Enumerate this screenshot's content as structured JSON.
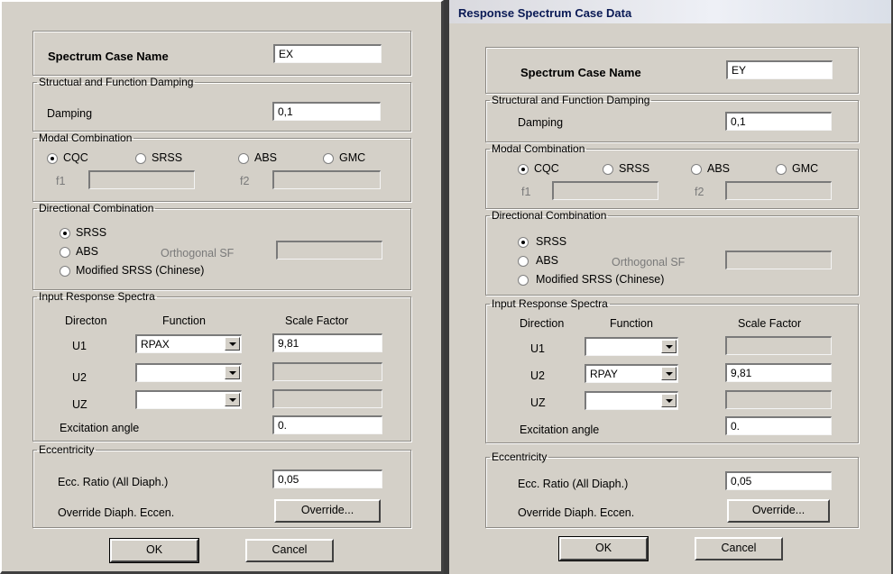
{
  "left": {
    "spectrum_case_name_label": "Spectrum Case Name",
    "spectrum_case_name_value": "EX",
    "damping_group": "Structual and Function Damping",
    "damping_label": "Damping",
    "damping_value": "0,1",
    "modal_group": "Modal Combination",
    "modal_options": [
      "CQC",
      "SRSS",
      "ABS",
      "GMC"
    ],
    "modal_selected": "CQC",
    "f1_label": "f1",
    "f2_label": "f2",
    "directional_group": "Directional Combination",
    "directional_options": [
      "SRSS",
      "ABS",
      "Modified SRSS (Chinese)"
    ],
    "directional_selected": "SRSS",
    "orthogonal_label": "Orthogonal SF",
    "input_group": "Input Response Spectra",
    "col_direction": "Directon",
    "col_function": "Function",
    "col_scale": "Scale Factor",
    "rows": [
      {
        "dir": "U1",
        "function": "RPAX",
        "scale": "9,81"
      },
      {
        "dir": "U2",
        "function": "",
        "scale": ""
      },
      {
        "dir": "UZ",
        "function": "",
        "scale": ""
      }
    ],
    "excitation_label": "Excitation angle",
    "excitation_value": "0.",
    "ecc_group": "Eccentricity",
    "ecc_ratio_label": "Ecc. Ratio (All Diaph.)",
    "ecc_ratio_value": "0,05",
    "override_label": "Override Diaph. Eccen.",
    "override_button": "Override...",
    "ok_button": "OK",
    "cancel_button": "Cancel"
  },
  "right": {
    "title": "Response Spectrum Case Data",
    "spectrum_case_name_label": "Spectrum Case Name",
    "spectrum_case_name_value": "EY",
    "damping_group": "Structural and Function Damping",
    "damping_label": "Damping",
    "damping_value": "0,1",
    "modal_group": "Modal Combination",
    "modal_options": [
      "CQC",
      "SRSS",
      "ABS",
      "GMC"
    ],
    "modal_selected": "CQC",
    "f1_label": "f1",
    "f2_label": "f2",
    "directional_group": "Directional Combination",
    "directional_options": [
      "SRSS",
      "ABS",
      "Modified SRSS (Chinese)"
    ],
    "directional_selected": "SRSS",
    "orthogonal_label": "Orthogonal SF",
    "input_group": "Input Response Spectra",
    "col_direction": "Direction",
    "col_function": "Function",
    "col_scale": "Scale Factor",
    "rows": [
      {
        "dir": "U1",
        "function": "",
        "scale": ""
      },
      {
        "dir": "U2",
        "function": "RPAY",
        "scale": "9,81"
      },
      {
        "dir": "UZ",
        "function": "",
        "scale": ""
      }
    ],
    "excitation_label": "Excitation angle",
    "excitation_value": "0.",
    "ecc_group": "Eccentricity",
    "ecc_ratio_label": "Ecc. Ratio (All Diaph.)",
    "ecc_ratio_value": "0,05",
    "override_label": "Override Diaph. Eccen.",
    "override_button": "Override...",
    "ok_button": "OK",
    "cancel_button": "Cancel"
  }
}
